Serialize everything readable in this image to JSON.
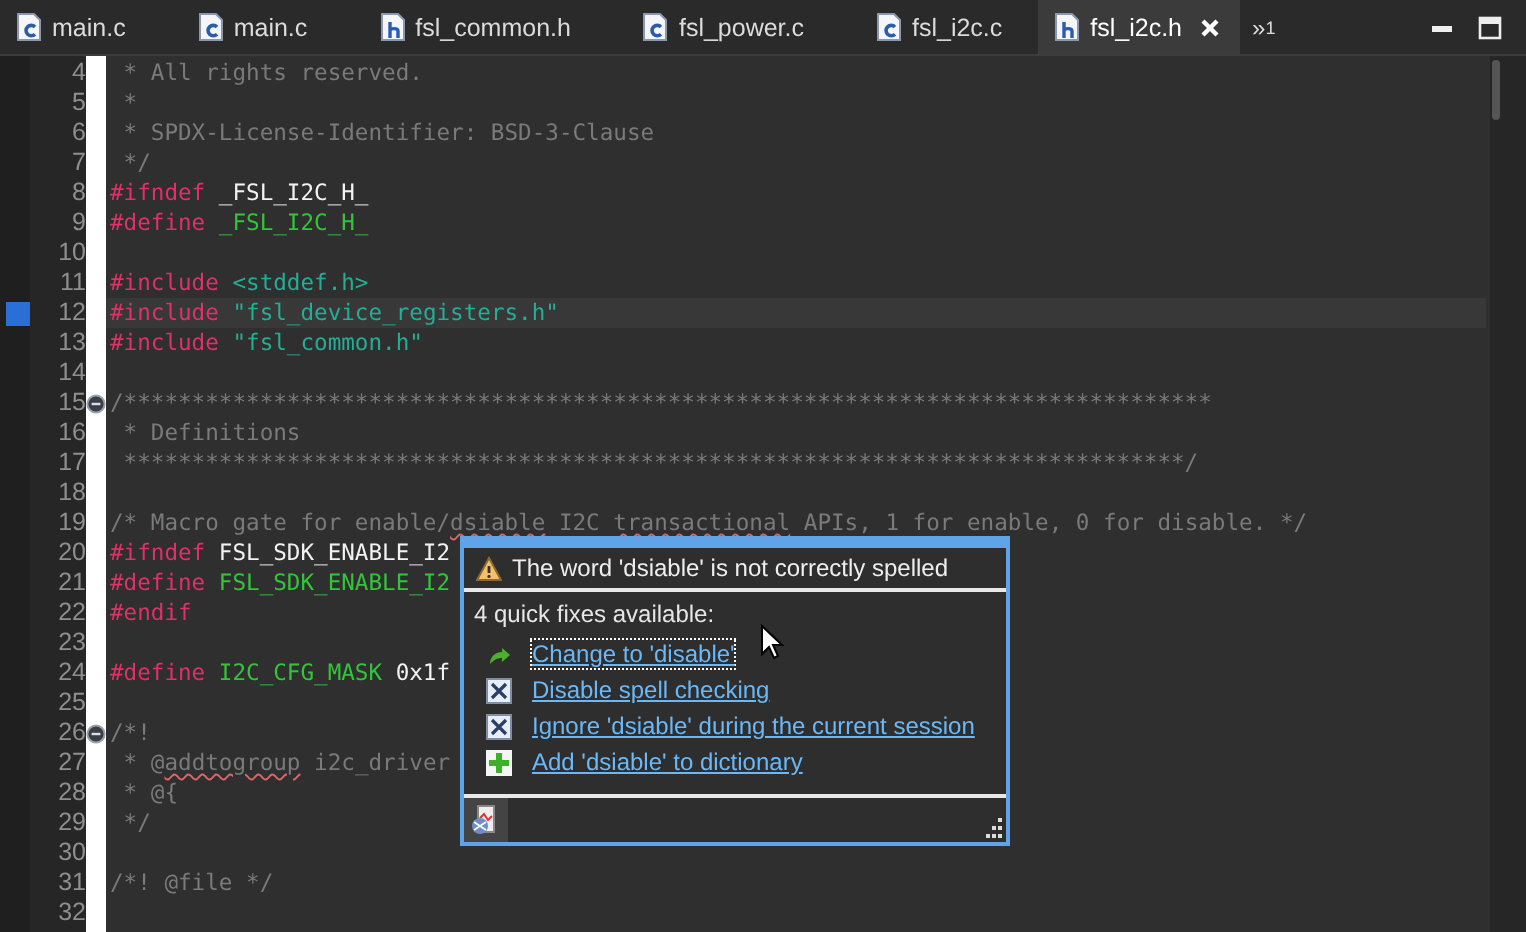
{
  "tabs": [
    {
      "kind": "source",
      "label": "main.c",
      "selected": false
    },
    {
      "kind": "source",
      "label": "main.c",
      "selected": false
    },
    {
      "kind": "header",
      "label": "fsl_common.h",
      "selected": false
    },
    {
      "kind": "source",
      "label": "fsl_power.c",
      "selected": false
    },
    {
      "kind": "source",
      "label": "fsl_i2c.c",
      "selected": false
    },
    {
      "kind": "header",
      "label": "fsl_i2c.h",
      "selected": true
    }
  ],
  "overflow": {
    "symbol": "»",
    "count": "1"
  },
  "editor": {
    "lines": [
      {
        "n": "4",
        "current": false,
        "collapsible": false,
        "segs": [
          {
            "t": " * All rights reserved.",
            "kind": "comment"
          }
        ]
      },
      {
        "n": "5",
        "current": false,
        "collapsible": false,
        "segs": [
          {
            "t": " *",
            "kind": "comment"
          }
        ]
      },
      {
        "n": "6",
        "current": false,
        "collapsible": false,
        "segs": [
          {
            "t": " * SPDX-License-Identifier: BSD-3-Clause",
            "kind": "comment"
          }
        ]
      },
      {
        "n": "7",
        "current": false,
        "collapsible": false,
        "segs": [
          {
            "t": " */",
            "kind": "comment"
          }
        ]
      },
      {
        "n": "8",
        "current": false,
        "collapsible": false,
        "segs": [
          {
            "t": "#ifndef",
            "kind": "directive"
          },
          {
            "t": " _FSL_I2C_H_",
            "kind": "macro"
          }
        ]
      },
      {
        "n": "9",
        "current": false,
        "collapsible": false,
        "segs": [
          {
            "t": "#define",
            "kind": "directive"
          },
          {
            "t": " _FSL_I2C_H_",
            "kind": "defined"
          }
        ]
      },
      {
        "n": "10",
        "current": false,
        "collapsible": false
      },
      {
        "n": "11",
        "current": false,
        "collapsible": false,
        "segs": [
          {
            "t": "#include",
            "kind": "directive"
          },
          {
            "t": " <stddef.h>",
            "kind": "string"
          }
        ]
      },
      {
        "n": "12",
        "current": true,
        "collapsible": false,
        "segs": [
          {
            "t": "#include",
            "kind": "directive"
          },
          {
            "t": " \"fsl_device_registers.h\"",
            "kind": "string"
          }
        ]
      },
      {
        "n": "13",
        "current": false,
        "collapsible": false,
        "segs": [
          {
            "t": "#include",
            "kind": "directive"
          },
          {
            "t": " \"fsl_common.h\"",
            "kind": "string"
          }
        ]
      },
      {
        "n": "14",
        "current": false,
        "collapsible": false
      },
      {
        "n": "15",
        "current": false,
        "collapsible": true,
        "segs": [
          {
            "t": "/********************************************************************************",
            "kind": "comment"
          }
        ]
      },
      {
        "n": "16",
        "current": false,
        "collapsible": false,
        "segs": [
          {
            "t": " * Definitions",
            "kind": "comment"
          }
        ]
      },
      {
        "n": "17",
        "current": false,
        "collapsible": false,
        "segs": [
          {
            "t": " ******************************************************************************/",
            "kind": "comment"
          }
        ]
      },
      {
        "n": "18",
        "current": false,
        "collapsible": false
      },
      {
        "n": "19",
        "current": false,
        "collapsible": false,
        "segs": [
          {
            "t": "/* Macro gate for enable/",
            "kind": "comment"
          },
          {
            "t": "dsiable",
            "kind": "comment",
            "misspelled": true
          },
          {
            "t": " I2C ",
            "kind": "comment"
          },
          {
            "t": "transactional",
            "kind": "comment",
            "misspelled": true
          },
          {
            "t": " APIs, 1 for enable, 0 for disable. */",
            "kind": "comment"
          }
        ]
      },
      {
        "n": "20",
        "current": false,
        "collapsible": false,
        "segs": [
          {
            "t": "#ifndef",
            "kind": "directive"
          },
          {
            "t": " FSL_SDK_ENABLE_I2",
            "kind": "macro"
          }
        ]
      },
      {
        "n": "21",
        "current": false,
        "collapsible": false,
        "segs": [
          {
            "t": "#define",
            "kind": "directive"
          },
          {
            "t": " FSL_SDK_ENABLE_I2",
            "kind": "defined"
          }
        ]
      },
      {
        "n": "22",
        "current": false,
        "collapsible": false,
        "segs": [
          {
            "t": "#endif",
            "kind": "directive"
          }
        ]
      },
      {
        "n": "23",
        "current": false,
        "collapsible": false
      },
      {
        "n": "24",
        "current": false,
        "collapsible": false,
        "segs": [
          {
            "t": "#define",
            "kind": "directive"
          },
          {
            "t": " I2C_CFG_MASK",
            "kind": "defined"
          },
          {
            "t": " 0x1f",
            "kind": "macro"
          }
        ]
      },
      {
        "n": "25",
        "current": false,
        "collapsible": false
      },
      {
        "n": "26",
        "current": false,
        "collapsible": true,
        "segs": [
          {
            "t": "/*!",
            "kind": "comment"
          }
        ]
      },
      {
        "n": "27",
        "current": false,
        "collapsible": false,
        "segs": [
          {
            "t": " * @",
            "kind": "comment"
          },
          {
            "t": "addtogroup",
            "kind": "comment",
            "misspelled": true
          },
          {
            "t": " i2c_driver",
            "kind": "comment"
          }
        ]
      },
      {
        "n": "28",
        "current": false,
        "collapsible": false,
        "segs": [
          {
            "t": " * @{",
            "kind": "comment"
          }
        ]
      },
      {
        "n": "29",
        "current": false,
        "collapsible": false,
        "segs": [
          {
            "t": " */",
            "kind": "comment"
          }
        ]
      },
      {
        "n": "30",
        "current": false,
        "collapsible": false
      },
      {
        "n": "31",
        "current": false,
        "collapsible": false,
        "segs": [
          {
            "t": "/*! @file */",
            "kind": "comment"
          }
        ]
      },
      {
        "n": "32",
        "current": false,
        "collapsible": false
      }
    ]
  },
  "popup": {
    "message": "The word 'dsiable' is not correctly spelled",
    "count_text": "4 quick fixes available:",
    "fixes": [
      {
        "kind": "change",
        "label": "Change to 'disable'",
        "selected": true
      },
      {
        "kind": "disable",
        "label": "Disable spell checking",
        "selected": false
      },
      {
        "kind": "ignore",
        "label": "Ignore 'dsiable' during the current session",
        "selected": false
      },
      {
        "kind": "add",
        "label": "Add 'dsiable' to dictionary",
        "selected": false
      }
    ]
  }
}
